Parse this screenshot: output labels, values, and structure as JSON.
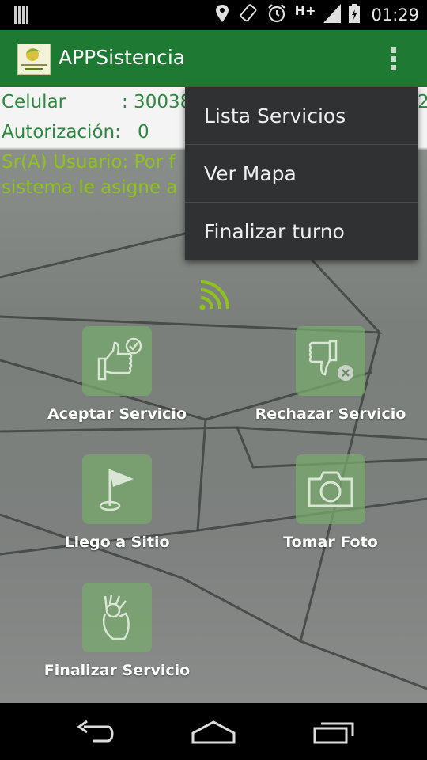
{
  "status_bar": {
    "time": "01:29",
    "network_label": "H+",
    "icons": [
      "sim-icon",
      "location-icon",
      "rotate-icon",
      "alarm-icon",
      "signal-icon",
      "battery-icon"
    ]
  },
  "action_bar": {
    "title": "APPSistencia",
    "background": "#1e7a33"
  },
  "info": {
    "celular_label": "Celular",
    "celular_value": ": 30038",
    "celular_tail": "2",
    "autorizacion_label": "Autorización:",
    "autorizacion_value": "0",
    "notice_line1": "Sr(A) Usuario: Por f",
    "notice_line2": "sistema le asigne a"
  },
  "menu": {
    "items": [
      "Lista Servicios",
      "Ver Mapa",
      "Finalizar turno"
    ]
  },
  "actions": {
    "accept": "Aceptar Servicio",
    "reject": "Rechazar Servicio",
    "arrived": "Llego a Sitio",
    "photo": "Tomar Foto",
    "finish": "Finalizar Servicio"
  },
  "colors": {
    "accent": "#1e7a33",
    "label_green": "#2b8a3e",
    "notice_green": "#8fc21f",
    "tile": "#78aa6e"
  }
}
